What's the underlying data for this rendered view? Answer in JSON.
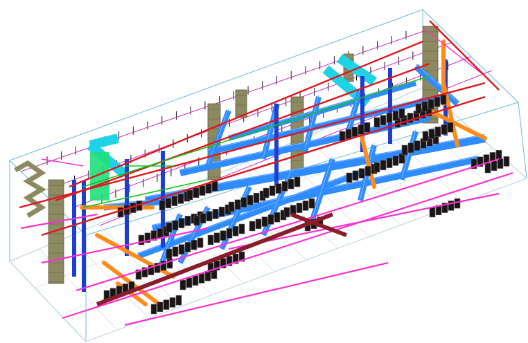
{
  "scene": {
    "subject": "isometric-mep-bim-model",
    "colors": {
      "background": "#ffffff",
      "boundary": "#6fb7d6",
      "supply_duct": "#2f8cff",
      "return_duct": "#1fd3e6",
      "supply_pipe": "#e0151e",
      "condensate_pipe": "#ff2fd0",
      "chilled_water": "#ff8c1a",
      "ahu_shaft": "#8d8a62",
      "gas_pipe": "#18c21e",
      "riser_blue": "#1c3fd1",
      "cable_tray": "#8a1d2b",
      "equipment_rack": "#1b1416",
      "rack_highlight": "#6c6a6b",
      "hanger": "#111111",
      "sprinkler": "#c82fb8"
    }
  }
}
